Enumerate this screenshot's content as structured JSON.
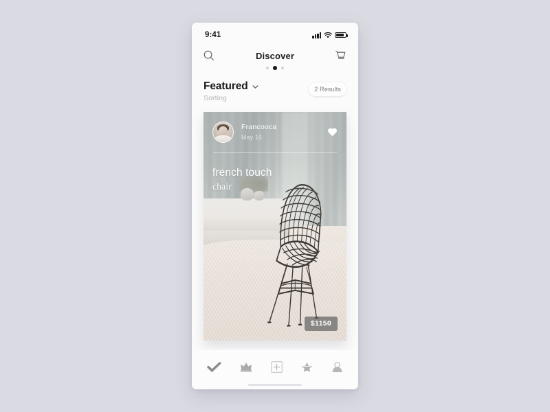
{
  "status_bar": {
    "time": "9:41",
    "signal_icon": "signal-bars-icon",
    "wifi_icon": "wifi-icon",
    "battery_icon": "battery-icon"
  },
  "nav": {
    "title": "Discover",
    "search_icon": "search-icon",
    "cart_icon": "shopping-cart-icon",
    "pager": {
      "total": 3,
      "active_index": 1
    }
  },
  "sorting": {
    "title": "Featured",
    "subtitle": "Sorting",
    "chevron_icon": "chevron-down-icon",
    "results_label": "2 Results"
  },
  "card": {
    "poster_name": "Francooca",
    "poster_date": "May 16",
    "favorite_icon": "heart-icon",
    "title": "french touch",
    "subtitle": "chair",
    "price": "$1150",
    "product_alt": "wire-frame chair"
  },
  "tabs": [
    {
      "name": "tab-check",
      "icon": "check-icon",
      "active": true
    },
    {
      "name": "tab-crown",
      "icon": "crown-icon",
      "active": false
    },
    {
      "name": "tab-add",
      "icon": "plus-square-icon",
      "active": false
    },
    {
      "name": "tab-star",
      "icon": "star-icon",
      "active": false
    },
    {
      "name": "tab-profile",
      "icon": "person-icon",
      "active": false
    }
  ],
  "colors": {
    "page_background": "#dadae2",
    "phone_background": "#fbfbfb",
    "text_primary": "#1b1b1d",
    "text_muted": "#b6b6bb",
    "price_pill": "rgba(95,95,95,.70)"
  }
}
